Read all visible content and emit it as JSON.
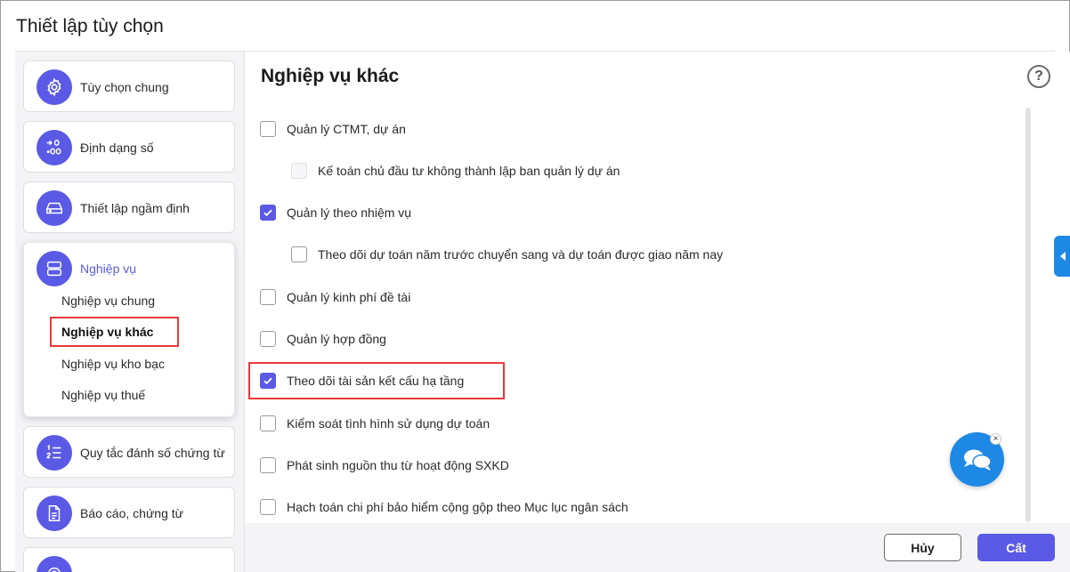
{
  "dialog": {
    "title": "Thiết lập tùy chọn"
  },
  "sidebar": {
    "cards": [
      {
        "label": "Tùy chọn chung",
        "icon": "gear-icon"
      },
      {
        "label": "Định dạng số",
        "icon": "number-format-icon"
      },
      {
        "label": "Thiết lập ngầm định",
        "icon": "hard-drive-icon"
      },
      {
        "label": "Nghiệp vụ",
        "icon": "server-icon",
        "sub_items": [
          "Nghiệp vụ chung",
          "Nghiệp vụ khác",
          "Nghiệp vụ kho bạc",
          "Nghiệp vụ thuế"
        ],
        "selected": "Nghiệp vụ khác"
      },
      {
        "label": "Quy tắc đánh số chứng từ",
        "icon": "numbered-list-icon"
      },
      {
        "label": "Báo cáo, chứng từ",
        "icon": "document-icon"
      }
    ]
  },
  "content": {
    "title": "Nghiệp vụ khác",
    "options": [
      {
        "label": "Quản lý CTMT, dự án",
        "checked": false
      },
      {
        "label": "Kế toán chủ đầu tư không thành lập ban quản lý dự án",
        "checked": false,
        "disabled": true
      },
      {
        "label": "Quản lý theo nhiệm vụ",
        "checked": true
      },
      {
        "label": "Theo dõi dự toán năm trước chuyển sang và dự toán được giao năm nay",
        "checked": false
      },
      {
        "label": "Quản lý kinh phí đề tài",
        "checked": false
      },
      {
        "label": "Quản lý hợp đồng",
        "checked": false
      },
      {
        "label": "Theo dõi tài sản kết cấu hạ tầng",
        "checked": true
      },
      {
        "label": "Kiểm soát tình hình sử dụng dự toán",
        "checked": false
      },
      {
        "label": "Phát sinh nguồn thu từ hoạt động SXKD",
        "checked": false
      },
      {
        "label": "Hạch toán chi phí bảo hiểm cộng gộp theo Mục lục ngân sách",
        "checked": false
      }
    ]
  },
  "footer": {
    "cancel_label": "Hủy",
    "save_label": "Cất"
  },
  "colors": {
    "accent": "#5a5ae6",
    "chat": "#1e88e5",
    "highlight": "#e8393a"
  }
}
